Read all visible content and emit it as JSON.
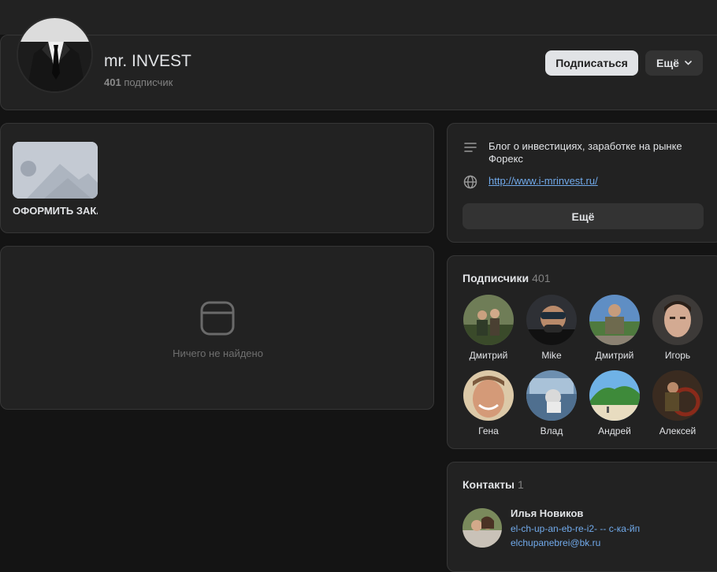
{
  "header": {
    "name": "mr. INVEST",
    "subscribers_count": "401",
    "subscribers_label": "подписчик",
    "subscribe_button": "Подписаться",
    "more_button": "Ещё"
  },
  "goods": {
    "label": "ОФОРМИТЬ ЗАКАЗ"
  },
  "empty": {
    "text": "Ничего не найдено"
  },
  "info": {
    "description": "Блог о инвестициях, заработке на рынке Форекс",
    "link": "http://www.i-mrinvest.ru/",
    "more_button": "Ещё"
  },
  "followers": {
    "title": "Подписчики",
    "count": "401",
    "items": [
      {
        "name": "Дмитрий",
        "icon": "avatar-photo"
      },
      {
        "name": "Mike",
        "icon": "avatar-photo"
      },
      {
        "name": "Дмитрий",
        "icon": "avatar-photo"
      },
      {
        "name": "Игорь",
        "icon": "avatar-photo"
      },
      {
        "name": "Гена",
        "icon": "avatar-photo"
      },
      {
        "name": "Влад",
        "icon": "avatar-photo"
      },
      {
        "name": "Андрей",
        "icon": "avatar-photo"
      },
      {
        "name": "Алексей",
        "icon": "avatar-photo"
      }
    ]
  },
  "contacts": {
    "title": "Контакты",
    "count": "1",
    "person": {
      "name": "Илья Новиков",
      "role": "el-ch-up-an-eb-re-i2- -- с-ка-йп",
      "email": "elchupanebrei@bk.ru"
    }
  },
  "colors": {
    "background": "#141414",
    "card": "#222222",
    "accent_link": "#71aaeb",
    "button_primary": "#e1e3e6"
  }
}
